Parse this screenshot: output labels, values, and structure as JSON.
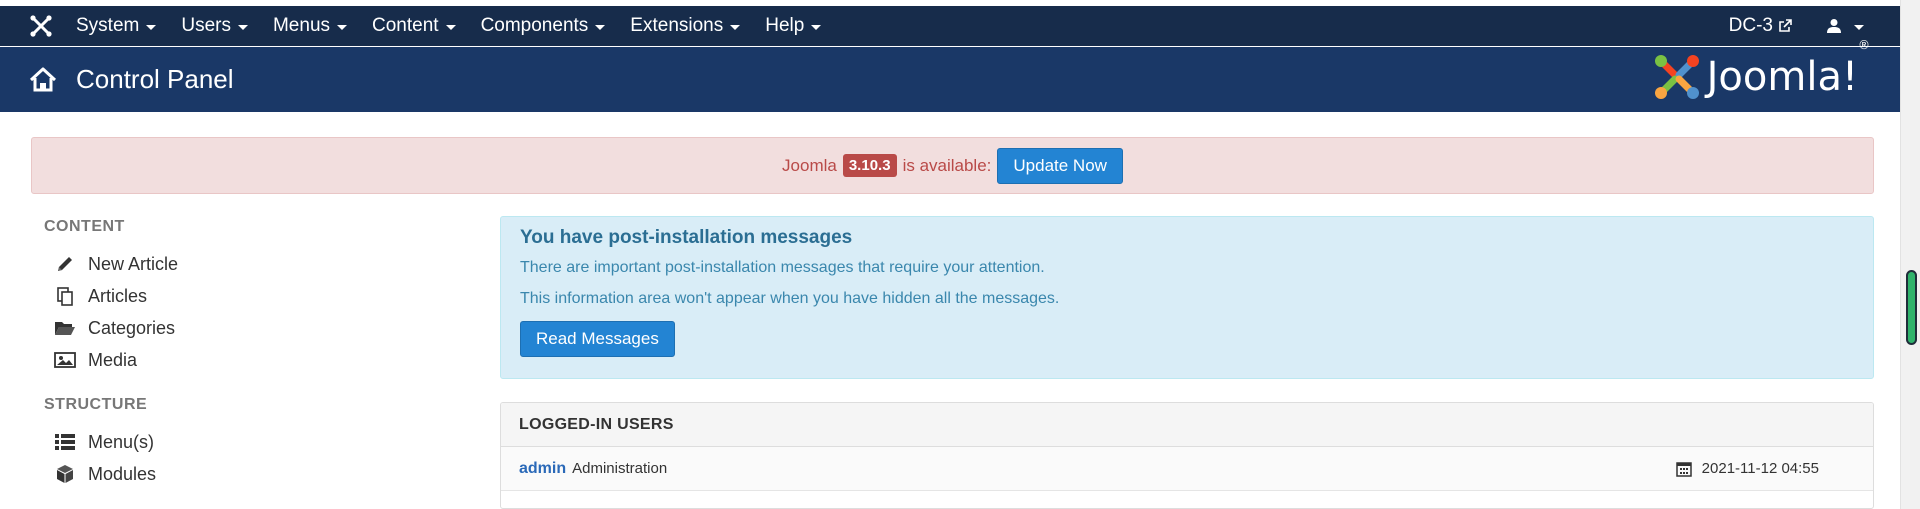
{
  "topbar": {
    "menu": [
      {
        "label": "System"
      },
      {
        "label": "Users"
      },
      {
        "label": "Menus"
      },
      {
        "label": "Content"
      },
      {
        "label": "Components"
      },
      {
        "label": "Extensions"
      },
      {
        "label": "Help"
      }
    ],
    "site_label": "DC-3",
    "icons": {
      "logo": "joomla-icon",
      "site_link": "external-link-icon",
      "user": "user-icon"
    }
  },
  "header": {
    "title": "Control Panel",
    "brand_text": "Joomla!",
    "brand_reg": "®",
    "icons": {
      "home": "home-icon"
    }
  },
  "update_alert": {
    "prefix": "Joomla",
    "version": "3.10.3",
    "suffix": "is available:",
    "button_label": "Update Now"
  },
  "sidebar": {
    "sections": [
      {
        "heading": "CONTENT",
        "items": [
          {
            "label": "New Article",
            "icon": "pencil-icon"
          },
          {
            "label": "Articles",
            "icon": "copy-icon"
          },
          {
            "label": "Categories",
            "icon": "folder-open-icon"
          },
          {
            "label": "Media",
            "icon": "image-icon"
          }
        ]
      },
      {
        "heading": "STRUCTURE",
        "items": [
          {
            "label": "Menu(s)",
            "icon": "list-icon"
          },
          {
            "label": "Modules",
            "icon": "cube-icon"
          }
        ]
      }
    ]
  },
  "postinstall": {
    "title": "You have post-installation messages",
    "line1": "There are important post-installation messages that require your attention.",
    "line2": "This information area won't appear when you have hidden all the messages.",
    "button_label": "Read Messages"
  },
  "logged_users": {
    "heading": "LOGGED-IN USERS",
    "rows": [
      {
        "name": "admin",
        "role": "Administration",
        "time": "2021-11-12 04:55"
      }
    ]
  },
  "colors": {
    "topbar": "#172c4b",
    "header": "#1a3867",
    "accent_button": "#2384d3",
    "alert_bg": "#f2dede",
    "alert_text": "#b94a48",
    "info_bg": "#d9edf7"
  }
}
